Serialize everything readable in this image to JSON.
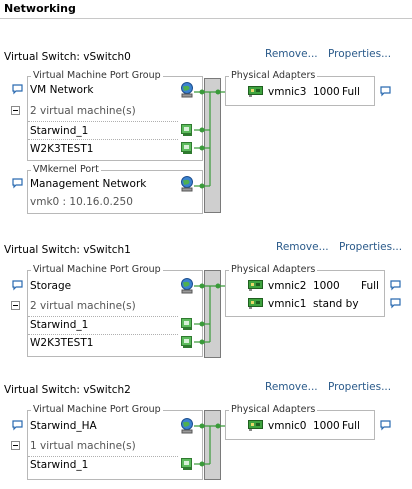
{
  "header": {
    "title": "Networking"
  },
  "actions": {
    "remove": "Remove...",
    "properties": "Properties..."
  },
  "switches": [
    {
      "label": "Virtual Switch: vSwitch0",
      "port_groups": [
        {
          "legend": "Virtual Machine Port Group",
          "name": "VM Network",
          "vm_count": "2 virtual machine(s)",
          "vms": [
            "Starwind_1",
            "W2K3TEST1"
          ]
        },
        {
          "legend": "VMkernel Port",
          "name": "Management Network",
          "detail": "vmk0 : 10.16.0.250"
        }
      ],
      "physical": {
        "legend": "Physical Adapters",
        "adapters": [
          {
            "name": "vmnic3",
            "speed": "1000",
            "duplex": "Full"
          }
        ]
      }
    },
    {
      "label": "Virtual Switch: vSwitch1",
      "port_groups": [
        {
          "legend": "Virtual Machine Port Group",
          "name": "Storage",
          "vm_count": "2 virtual machine(s)",
          "vms": [
            "Starwind_1",
            "W2K3TEST1"
          ]
        }
      ],
      "physical": {
        "legend": "Physical Adapters",
        "adapters": [
          {
            "name": "vmnic2",
            "speed": "1000",
            "duplex": "Full"
          },
          {
            "name": "vmnic1",
            "speed": "stand by",
            "duplex": ""
          }
        ]
      }
    },
    {
      "label": "Virtual Switch: vSwitch2",
      "port_groups": [
        {
          "legend": "Virtual Machine Port Group",
          "name": "Starwind_HA",
          "vm_count": "1 virtual machine(s)",
          "vms": [
            "Starwind_1"
          ]
        }
      ],
      "physical": {
        "legend": "Physical Adapters",
        "adapters": [
          {
            "name": "vmnic0",
            "speed": "1000",
            "duplex": "Full"
          }
        ]
      }
    }
  ],
  "colors": {
    "link": "#2a5a8a",
    "port_green": "#3a9a3a",
    "nic_green": "#2f8a2f",
    "globe_blue": "#2f6fc0"
  }
}
